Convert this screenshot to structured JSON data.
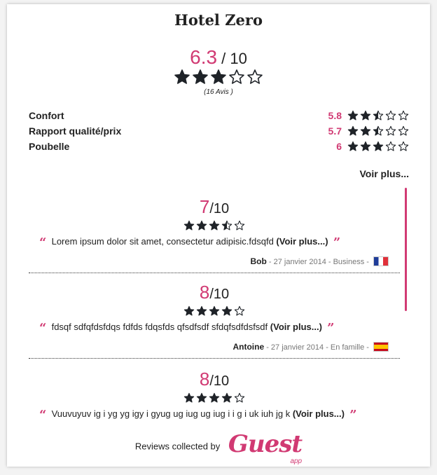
{
  "hotel": {
    "name": "Hotel Zero"
  },
  "global": {
    "score": "6.3",
    "outof": " / 10",
    "rating": 3,
    "reviews_count": "(16 Avis )"
  },
  "criteria": [
    {
      "label": "Confort",
      "value": "5.8",
      "rating": 2.5
    },
    {
      "label": "Rapport qualité/prix",
      "value": "5.7",
      "rating": 2.5
    },
    {
      "label": "Poubelle",
      "value": "6",
      "rating": 3
    }
  ],
  "see_more_label": "Voir plus...",
  "reviews": [
    {
      "score": "7",
      "outof": "/10",
      "rating": 3.5,
      "text": "Lorem ipsum dolor sit amet, consectetur adipisic.fdsqfd",
      "more_label": "(Voir plus...)",
      "author": "Bob",
      "details": " - 27 janvier 2014 - Business - ",
      "flag": "fr"
    },
    {
      "score": "8",
      "outof": "/10",
      "rating": 4,
      "text": "fdsqf sdfqfdsfdqs fdfds fdqsfds qfsdfsdf sfdqfsdfdsfsdf",
      "more_label": "(Voir plus...)",
      "author": "Antoine",
      "details": " - 27 janvier 2014 - En famille - ",
      "flag": "es"
    },
    {
      "score": "8",
      "outof": "/10",
      "rating": 4,
      "text": "Vuuvuyuv ig i yg yg igy i gyug ug iug ug iug i i g i uk iuh jg k",
      "more_label": "(Voir plus...)"
    }
  ],
  "footer": {
    "collected_by": "Reviews collected by",
    "logo_text": "Guest",
    "logo_sub": "app"
  },
  "colors": {
    "accent": "#d13a73",
    "text": "#222222"
  }
}
